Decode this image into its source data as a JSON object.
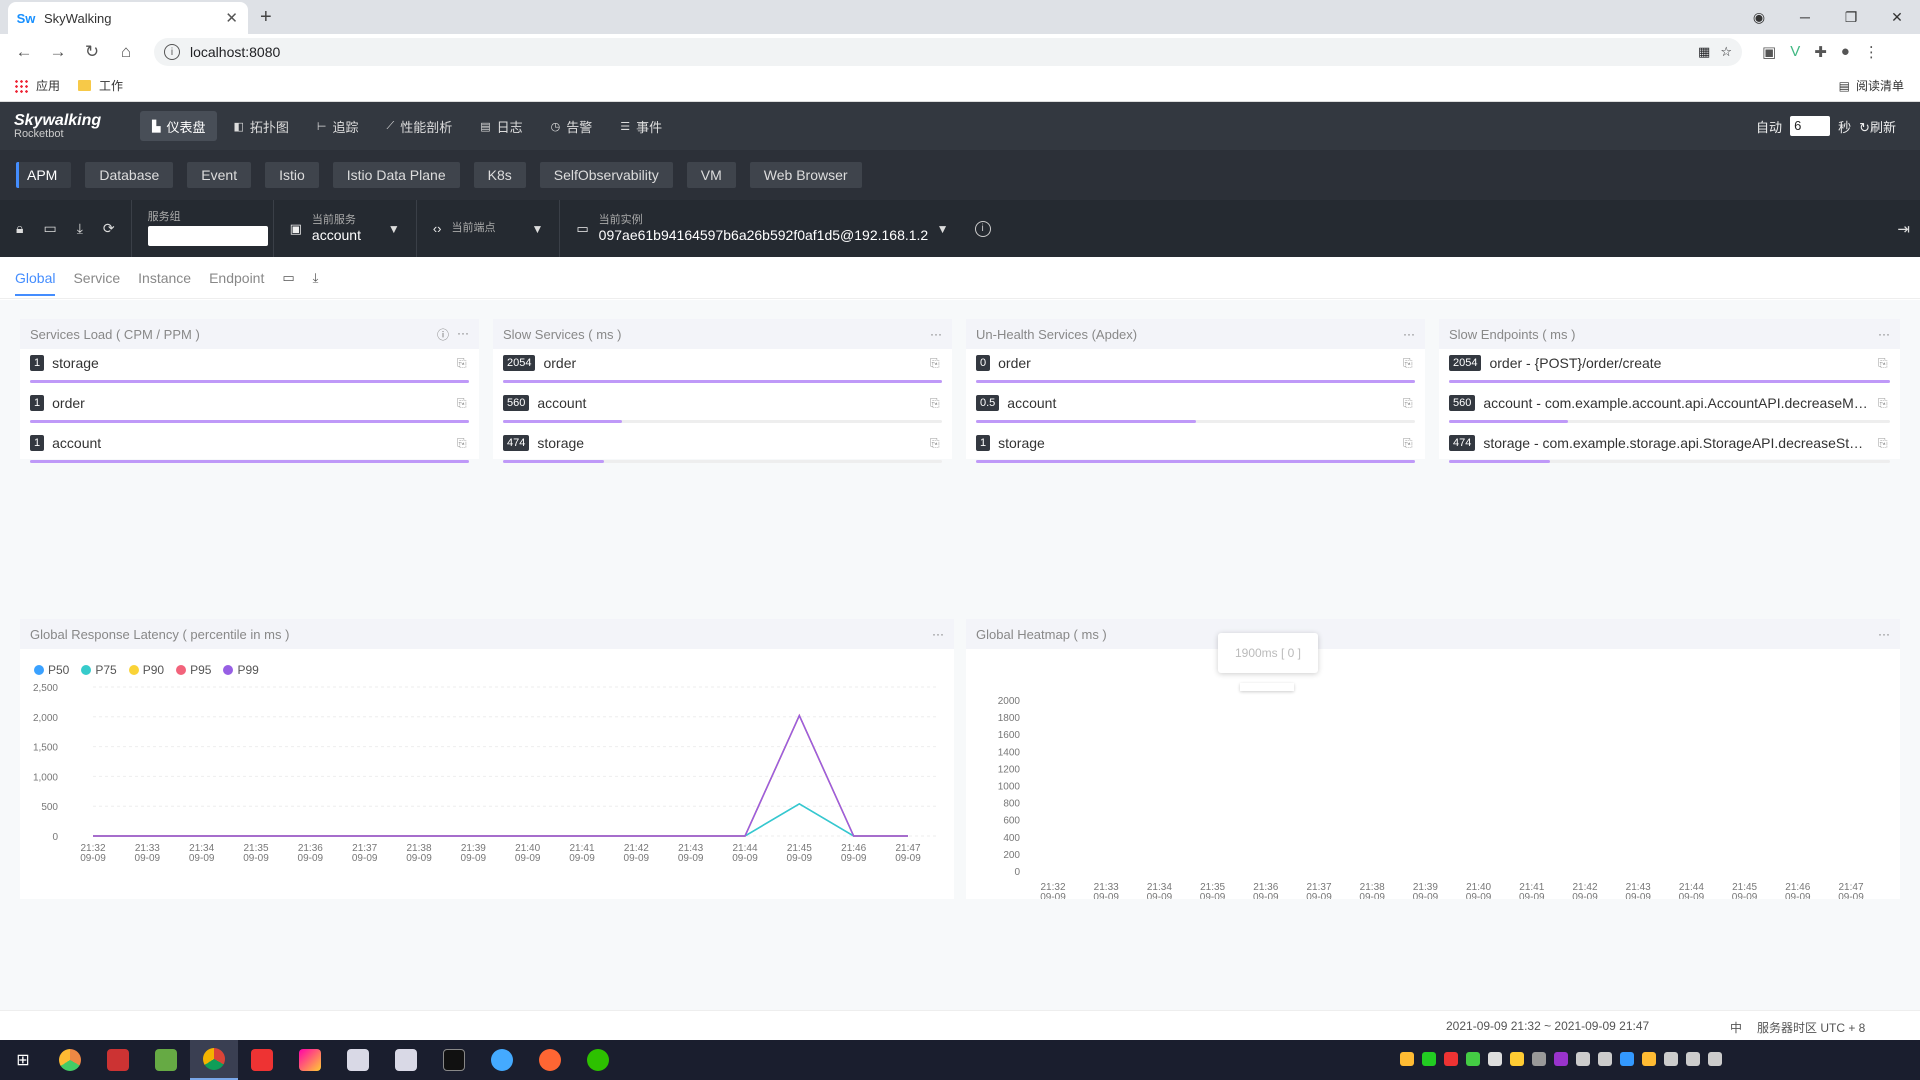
{
  "browser": {
    "tab_title": "SkyWalking",
    "favicon": "Sw",
    "url": "localhost:8080",
    "bookmarks": {
      "apps": "应用",
      "work": "工作",
      "reading": "阅读清单"
    }
  },
  "app": {
    "logo_name": "Skywalking",
    "logo_sub": "Rocketbot",
    "nav": [
      {
        "label": "仪表盘",
        "icon": "dashboard-icon"
      },
      {
        "label": "拓扑图",
        "icon": "topology-icon"
      },
      {
        "label": "追踪",
        "icon": "trace-icon"
      },
      {
        "label": "性能剖析",
        "icon": "profile-icon"
      },
      {
        "label": "日志",
        "icon": "log-icon"
      },
      {
        "label": "告警",
        "icon": "alarm-icon"
      },
      {
        "label": "事件",
        "icon": "event-icon"
      }
    ],
    "auto_label": "自动",
    "interval": "6",
    "seconds": "秒",
    "refresh": "刷新"
  },
  "layers": [
    "APM",
    "Database",
    "Event",
    "Istio",
    "Istio Data Plane",
    "K8s",
    "SelfObservability",
    "VM",
    "Web Browser"
  ],
  "selectors": {
    "group_label": "服务组",
    "group_value": "",
    "service_label": "当前服务",
    "service_value": "account",
    "endpoint_label": "当前端点",
    "endpoint_value": "",
    "instance_label": "当前实例",
    "instance_value": "097ae61b94164597b6a26b592f0af1d5@192.168.1.2"
  },
  "dash_tabs": [
    "Global",
    "Service",
    "Instance",
    "Endpoint"
  ],
  "panels": [
    {
      "title": "Services Load ( CPM / PPM )",
      "rows": [
        {
          "v": "1",
          "n": "storage",
          "p": 100
        },
        {
          "v": "1",
          "n": "order",
          "p": 100
        },
        {
          "v": "1",
          "n": "account",
          "p": 100
        }
      ]
    },
    {
      "title": "Slow Services ( ms )",
      "rows": [
        {
          "v": "2054",
          "n": "order",
          "p": 100
        },
        {
          "v": "560",
          "n": "account",
          "p": 27
        },
        {
          "v": "474",
          "n": "storage",
          "p": 23
        }
      ]
    },
    {
      "title": "Un-Health Services (Apdex)",
      "rows": [
        {
          "v": "0",
          "n": "order",
          "p": 100
        },
        {
          "v": "0.5",
          "n": "account",
          "p": 50
        },
        {
          "v": "1",
          "n": "storage",
          "p": 100
        }
      ]
    },
    {
      "title": "Slow Endpoints ( ms )",
      "rows": [
        {
          "v": "2054",
          "n": "order - {POST}/order/create",
          "p": 100
        },
        {
          "v": "560",
          "n": "account - com.example.account.api.AccountAPI.decreaseMo...",
          "p": 27
        },
        {
          "v": "474",
          "n": "storage - com.example.storage.api.StorageAPI.decreaseStor...",
          "p": 23
        }
      ]
    }
  ],
  "latency_title": "Global Response Latency ( percentile in ms )",
  "heatmap_title": "Global Heatmap ( ms )",
  "heatmap_tooltip": "1900ms [ 0 ]",
  "chart_data": [
    {
      "type": "line",
      "title": "Global Response Latency ( percentile in ms )",
      "categories": [
        "21:32\n09-09",
        "21:33\n09-09",
        "21:34\n09-09",
        "21:35\n09-09",
        "21:36\n09-09",
        "21:37\n09-09",
        "21:38\n09-09",
        "21:39\n09-09",
        "21:40\n09-09",
        "21:41\n09-09",
        "21:42\n09-09",
        "21:43\n09-09",
        "21:44\n09-09",
        "21:45\n09-09",
        "21:46\n09-09",
        "21:47\n09-09"
      ],
      "yticks": [
        "0",
        "500",
        "1,000",
        "1,500",
        "2,000",
        "2,500"
      ],
      "ylim": [
        0,
        2500
      ],
      "series": [
        {
          "name": "P50",
          "color": "#3aa1ff",
          "values": [
            0,
            0,
            0,
            0,
            0,
            0,
            0,
            0,
            0,
            0,
            0,
            0,
            0,
            540,
            0,
            0
          ]
        },
        {
          "name": "P75",
          "color": "#36cbcb",
          "values": [
            0,
            0,
            0,
            0,
            0,
            0,
            0,
            0,
            0,
            0,
            0,
            0,
            0,
            540,
            0,
            0
          ]
        },
        {
          "name": "P90",
          "color": "#fad337",
          "values": [
            0,
            0,
            0,
            0,
            0,
            0,
            0,
            0,
            0,
            0,
            0,
            0,
            0,
            2020,
            0,
            0
          ]
        },
        {
          "name": "P95",
          "color": "#f2637b",
          "values": [
            0,
            0,
            0,
            0,
            0,
            0,
            0,
            0,
            0,
            0,
            0,
            0,
            0,
            2020,
            0,
            0
          ]
        },
        {
          "name": "P99",
          "color": "#975fe4",
          "values": [
            0,
            0,
            0,
            0,
            0,
            0,
            0,
            0,
            0,
            0,
            0,
            0,
            0,
            2020,
            0,
            0
          ]
        }
      ],
      "legend": "top-left",
      "grid": true
    },
    {
      "type": "heatmap",
      "title": "Global Heatmap ( ms )",
      "categories": [
        "21:32\n09-09",
        "21:33\n09-09",
        "21:34\n09-09",
        "21:35\n09-09",
        "21:36\n09-09",
        "21:37\n09-09",
        "21:38\n09-09",
        "21:39\n09-09",
        "21:40\n09-09",
        "21:41\n09-09",
        "21:42\n09-09",
        "21:43\n09-09",
        "21:44\n09-09",
        "21:45\n09-09",
        "21:46\n09-09",
        "21:47\n09-09"
      ],
      "yticks": [
        "0",
        "200",
        "400",
        "600",
        "800",
        "1000",
        "1200",
        "1400",
        "1600",
        "1800",
        "2000"
      ],
      "ylim": [
        0,
        2000
      ]
    }
  ],
  "footer": {
    "time_range": "2021-09-09 21:32 ~ 2021-09-09 21:47",
    "lang": "中",
    "timezone": "服务器时区 UTC + 8"
  },
  "colors": {
    "accent": "#448dfe",
    "bar_fill": "#bf99f8",
    "header_bg": "#333840"
  }
}
